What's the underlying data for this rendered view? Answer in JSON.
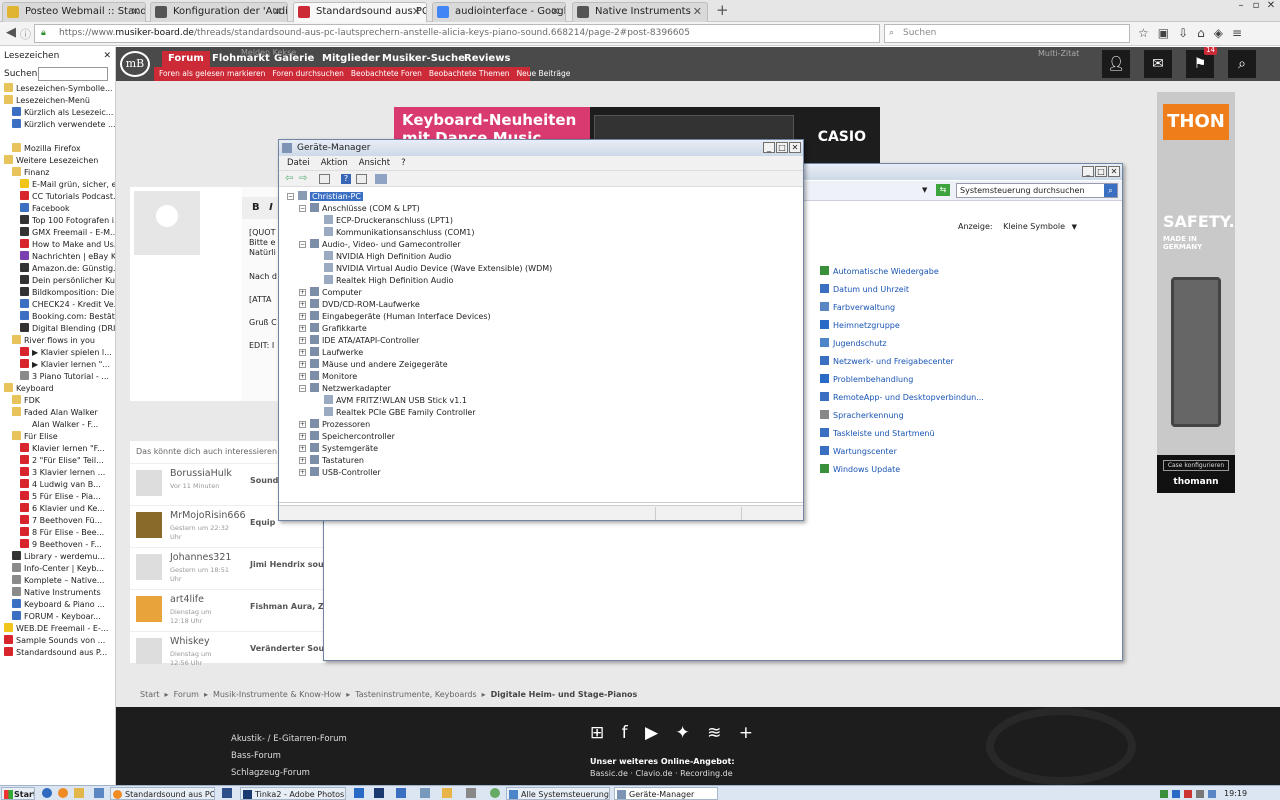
{
  "browser": {
    "tabs": [
      {
        "label": "Posteo Webmail :: Standar...",
        "color": "#e0b430"
      },
      {
        "label": "Konfiguration der 'Audio a...",
        "color": "#555555"
      },
      {
        "label": "Standardsound aus PC Lau...",
        "color": "#cc2a36"
      },
      {
        "label": "audiointerface - Google-Su...",
        "color": "#4285f4"
      },
      {
        "label": "Native Instruments",
        "color": "#555555"
      }
    ],
    "url_prefix": "https://www.",
    "url_domain": "musiker-board.de",
    "url_rest": "/threads/standardsound-aus-pc-lautsprechern-anstelle-alicia-keys-piano-sound.668214/page-2#post-8396605",
    "search_placeholder": "Suchen"
  },
  "sidebar": {
    "title": "Lesezeichen",
    "search_label": "Suchen:",
    "items": [
      {
        "label": "Lesezeichen-Symbolle...",
        "indent": 0,
        "kind": "folder"
      },
      {
        "label": "Lesezeichen-Menü",
        "indent": 0,
        "kind": "folder"
      },
      {
        "label": "Kürzlich als Lesezeic...",
        "indent": 1,
        "kind": "blue"
      },
      {
        "label": "Kürzlich verwendete ...",
        "indent": 1,
        "kind": "blue"
      },
      {
        "label": "",
        "indent": 0,
        "kind": "none"
      },
      {
        "label": "Mozilla Firefox",
        "indent": 1,
        "kind": "folder"
      },
      {
        "label": "Weitere Lesezeichen",
        "indent": 0,
        "kind": "folder"
      },
      {
        "label": "Finanz",
        "indent": 1,
        "kind": "folder"
      },
      {
        "label": "E-Mail grün, sicher, e...",
        "indent": 2,
        "kind": "yellow"
      },
      {
        "label": "CC Tutorials Podcast...",
        "indent": 2,
        "kind": "red"
      },
      {
        "label": "Facebook",
        "indent": 2,
        "kind": "blue"
      },
      {
        "label": "Top 100 Fotografen i...",
        "indent": 2,
        "kind": "black"
      },
      {
        "label": "GMX Freemail - E-M...",
        "indent": 2,
        "kind": "black"
      },
      {
        "label": "How to Make and Us...",
        "indent": 2,
        "kind": "red"
      },
      {
        "label": "Nachrichten | eBay K...",
        "indent": 2,
        "kind": "purple"
      },
      {
        "label": "Amazon.de: Günstig...",
        "indent": 2,
        "kind": "black"
      },
      {
        "label": "Dein persönlicher Ku...",
        "indent": 2,
        "kind": "black"
      },
      {
        "label": "Bildkomposition: Die...",
        "indent": 2,
        "kind": "black"
      },
      {
        "label": "CHECK24 - Kredit Ve...",
        "indent": 2,
        "kind": "blue"
      },
      {
        "label": "Booking.com: Bestät...",
        "indent": 2,
        "kind": "blue"
      },
      {
        "label": "Digital Blending (DRI...",
        "indent": 2,
        "kind": "black"
      },
      {
        "label": "River flows in you",
        "indent": 1,
        "kind": "folder"
      },
      {
        "label": "▶ Klavier spielen l...",
        "indent": 2,
        "kind": "red"
      },
      {
        "label": "▶ Klavier lernen \"...",
        "indent": 2,
        "kind": "red"
      },
      {
        "label": "3 Piano Tutorial - ...",
        "indent": 2,
        "kind": "gray"
      },
      {
        "label": "Keyboard",
        "indent": 0,
        "kind": "folder"
      },
      {
        "label": "FDK",
        "indent": 1,
        "kind": "folder"
      },
      {
        "label": "Faded Alan Walker",
        "indent": 1,
        "kind": "folder"
      },
      {
        "label": "Alan Walker - F...",
        "indent": 2,
        "kind": "none"
      },
      {
        "label": "Für Elise",
        "indent": 1,
        "kind": "folder"
      },
      {
        "label": "Klavier lernen \"F...",
        "indent": 2,
        "kind": "red"
      },
      {
        "label": "2 \"Für Elise\" Teil...",
        "indent": 2,
        "kind": "red"
      },
      {
        "label": "3 Klavier lernen ...",
        "indent": 2,
        "kind": "red"
      },
      {
        "label": "4 Ludwig van B...",
        "indent": 2,
        "kind": "red"
      },
      {
        "label": "5 Für Elise - Pia...",
        "indent": 2,
        "kind": "red"
      },
      {
        "label": "6 Klavier und Ke...",
        "indent": 2,
        "kind": "red"
      },
      {
        "label": "7 Beethoven Fü...",
        "indent": 2,
        "kind": "red"
      },
      {
        "label": "8 Für Elise - Bee...",
        "indent": 2,
        "kind": "red"
      },
      {
        "label": "9 Beethoven - F...",
        "indent": 2,
        "kind": "red"
      },
      {
        "label": "Library - werdemu...",
        "indent": 1,
        "kind": "black"
      },
      {
        "label": "Info-Center | Keyb...",
        "indent": 1,
        "kind": "gray"
      },
      {
        "label": "Komplete – Native...",
        "indent": 1,
        "kind": "gray"
      },
      {
        "label": "Native Instruments",
        "indent": 1,
        "kind": "gray"
      },
      {
        "label": "Keyboard & Piano ...",
        "indent": 1,
        "kind": "blue"
      },
      {
        "label": "FORUM - Keyboar...",
        "indent": 1,
        "kind": "blue"
      },
      {
        "label": "WEB.DE Freemail - E-...",
        "indent": 0,
        "kind": "yellow"
      },
      {
        "label": "Sample Sounds von ...",
        "indent": 0,
        "kind": "red"
      },
      {
        "label": "Standardsound aus P...",
        "indent": 0,
        "kind": "red"
      }
    ]
  },
  "site": {
    "logo": "mB",
    "nav": [
      "Forum",
      "Flohmarkt",
      "Galerie",
      "Mitglieder",
      "Musiker-Suche",
      "Reviews"
    ],
    "subnav": [
      "Foren als gelesen markieren",
      "Foren durchsuchen",
      "Beobachtete Foren",
      "Beobachtete Themen",
      "Neue Beiträge"
    ],
    "header_right_badge": "14",
    "ghost_text": "Melden    Kekse",
    "multi_zitat": "Multi-Zitat",
    "ad_banner": {
      "line1": "Keyboard-Neuheiten",
      "line2": "mit Dance Music Mode",
      "brand": "CASIO"
    },
    "ad_right": {
      "brand": "THON",
      "slogan1": "SAFETY.",
      "slogan2": "MADE IN GERMANY",
      "button": "Case konfigurieren",
      "shop": "thomann"
    },
    "editor_bold": "B",
    "editor_italic": "I",
    "post_lines": [
      "[QUOT",
      "Bitte e",
      "Natürli",
      "Nach d",
      "[ATTA",
      "Gruß C",
      "EDIT: I"
    ],
    "related_title": "Das könnte dich auch interessieren",
    "related": [
      {
        "user": "BorussiaHulk",
        "time": "Vor 11 Minuten",
        "title": "Sound"
      },
      {
        "user": "MrMojoRisin666",
        "time": "Gestern um 22:32 Uhr",
        "title": "Equip"
      },
      {
        "user": "Johannes321",
        "time": "Gestern um 18:51 Uhr",
        "title": "Jimi Hendrix sou"
      },
      {
        "user": "art4life",
        "time": "Dienstag um 12:18 Uhr",
        "title": "Fishman Aura, ZO"
      },
      {
        "user": "Whiskey",
        "time": "Dienstag um 12:56 Uhr",
        "title": "Veränderter Sou"
      }
    ],
    "breadcrumb": [
      "Start",
      "Forum",
      "Musik-Instrumente & Know-How",
      "Tasteninstrumente, Keyboards",
      "Digitale Heim- und Stage-Pianos"
    ],
    "footer_links": [
      "Akustik- / E-Gitarren-Forum",
      "Bass-Forum",
      "Schlagzeug-Forum"
    ],
    "footer_offer_title": "Unser weiteres Online-Angebot:",
    "footer_offer_links": "Bassic.de · Clavio.de · Recording.de"
  },
  "control_panel": {
    "search_placeholder": "Systemsteuerung durchsuchen",
    "view_label": "Anzeige:",
    "view_value": "Kleine Symbole",
    "links": [
      "Automatische Wiedergabe",
      "Datum und Uhrzeit",
      "Farbverwaltung",
      "Heimnetzgruppe",
      "Jugendschutz",
      "Netzwerk- und Freigabecenter",
      "Problembehandlung",
      "RemoteApp- und Desktopverbindun...",
      "Spracherkennung",
      "Taskleiste und Startmenü",
      "Wartungscenter",
      "Windows Update"
    ]
  },
  "device_manager": {
    "title": "Geräte-Manager",
    "menus": [
      "Datei",
      "Aktion",
      "Ansicht",
      "?"
    ],
    "root": "Christian-PC",
    "tree": [
      {
        "label": "Anschlüsse (COM & LPT)",
        "level": 1,
        "expander": "-"
      },
      {
        "label": "ECP-Druckeranschluss (LPT1)",
        "level": 2,
        "expander": ""
      },
      {
        "label": "Kommunikationsanschluss (COM1)",
        "level": 2,
        "expander": ""
      },
      {
        "label": "Audio-, Video- und Gamecontroller",
        "level": 1,
        "expander": "-"
      },
      {
        "label": "NVIDIA High Definition Audio",
        "level": 2,
        "expander": ""
      },
      {
        "label": "NVIDIA Virtual Audio Device (Wave Extensible) (WDM)",
        "level": 2,
        "expander": ""
      },
      {
        "label": "Realtek High Definition Audio",
        "level": 2,
        "expander": ""
      },
      {
        "label": "Computer",
        "level": 1,
        "expander": "+"
      },
      {
        "label": "DVD/CD-ROM-Laufwerke",
        "level": 1,
        "expander": "+"
      },
      {
        "label": "Eingabegeräte (Human Interface Devices)",
        "level": 1,
        "expander": "+"
      },
      {
        "label": "Grafikkarte",
        "level": 1,
        "expander": "+"
      },
      {
        "label": "IDE ATA/ATAPI-Controller",
        "level": 1,
        "expander": "+"
      },
      {
        "label": "Laufwerke",
        "level": 1,
        "expander": "+"
      },
      {
        "label": "Mäuse und andere Zeigegeräte",
        "level": 1,
        "expander": "+"
      },
      {
        "label": "Monitore",
        "level": 1,
        "expander": "+"
      },
      {
        "label": "Netzwerkadapter",
        "level": 1,
        "expander": "-"
      },
      {
        "label": "AVM FRITZ!WLAN USB Stick v1.1",
        "level": 2,
        "expander": ""
      },
      {
        "label": "Realtek PCIe GBE Family Controller",
        "level": 2,
        "expander": ""
      },
      {
        "label": "Prozessoren",
        "level": 1,
        "expander": "+"
      },
      {
        "label": "Speichercontroller",
        "level": 1,
        "expander": "+"
      },
      {
        "label": "Systemgeräte",
        "level": 1,
        "expander": "+"
      },
      {
        "label": "Tastaturen",
        "level": 1,
        "expander": "+"
      },
      {
        "label": "USB-Controller",
        "level": 1,
        "expander": "+"
      }
    ]
  },
  "taskbar": {
    "start": "Start",
    "items": [
      "Standardsound aus PC ...",
      "Tinka2 - Adobe Photos...",
      "Alle Systemsteuerungs...",
      "Geräte-Manager"
    ],
    "clock": "19:19"
  }
}
